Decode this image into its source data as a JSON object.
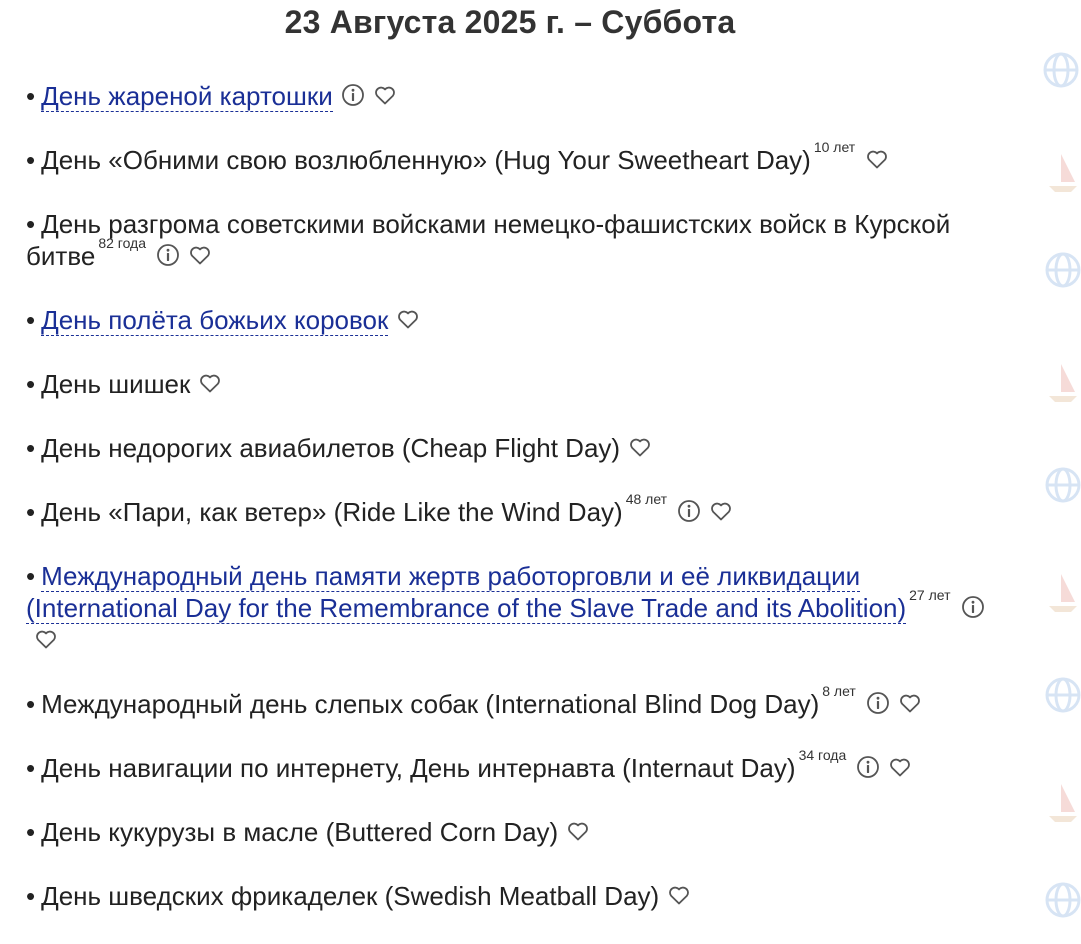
{
  "page": {
    "title": "23 Августа 2025 г. – Суббота"
  },
  "holidays": [
    {
      "text": "День жареной картошки",
      "link": true,
      "age": "",
      "info": true,
      "favorite": true
    },
    {
      "text": "День «Обними свою возлюбленную» (Hug Your Sweetheart Day)",
      "link": false,
      "age": "10 лет",
      "info": false,
      "favorite": true
    },
    {
      "text": "День разгрома советскими войсками немецко-фашистских войск в Курской битве",
      "link": false,
      "age": "82 года",
      "info": true,
      "favorite": true
    },
    {
      "text": "День полёта божьих коровок",
      "link": true,
      "age": "",
      "info": false,
      "favorite": true
    },
    {
      "text": "День шишек",
      "link": false,
      "age": "",
      "info": false,
      "favorite": true
    },
    {
      "text": "День недорогих авиабилетов (Cheap Flight Day)",
      "link": false,
      "age": "",
      "info": false,
      "favorite": true
    },
    {
      "text": "День «Пари, как ветер» (Ride Like the Wind Day)",
      "link": false,
      "age": "48 лет",
      "info": true,
      "favorite": true
    },
    {
      "text": "Международный день памяти жертв работорговли и её ликвидации (International Day for the Remembrance of the Slave Trade and its Abolition)",
      "link": true,
      "age": "27 лет",
      "info": true,
      "favorite": true
    },
    {
      "text": "Международный день слепых собак (International Blind Dog Day)",
      "link": false,
      "age": "8 лет",
      "info": true,
      "favorite": true
    },
    {
      "text": "День навигации по интернету, День интернавта (Internaut Day)",
      "link": false,
      "age": "34 года",
      "info": true,
      "favorite": true
    },
    {
      "text": "День кукурузы в масле (Buttered Corn Day)",
      "link": false,
      "age": "",
      "info": false,
      "favorite": true
    },
    {
      "text": "День шведских фрикаделек (Swedish Meatball Day)",
      "link": false,
      "age": "",
      "info": false,
      "favorite": true
    }
  ],
  "colors": {
    "link": "#1a2f96",
    "text": "#222222",
    "icon": "#555555"
  },
  "icons": {
    "info": "info-icon",
    "favorite": "heart-icon"
  }
}
